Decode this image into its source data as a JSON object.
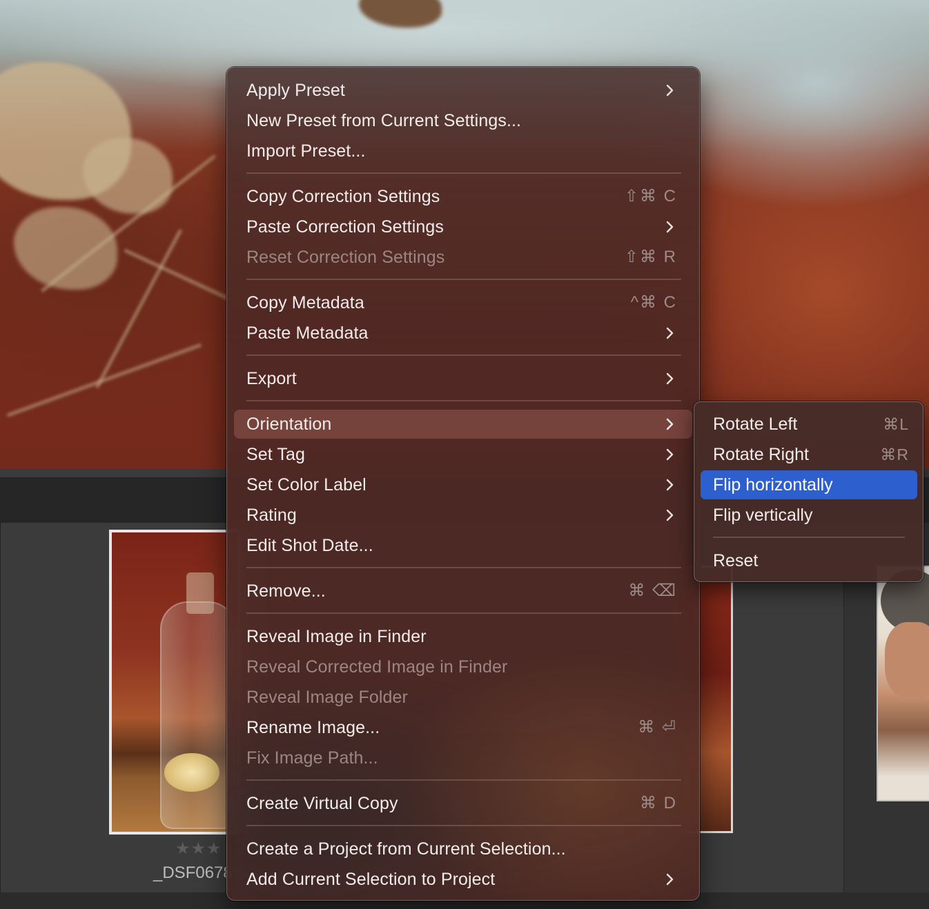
{
  "menu": {
    "items": [
      {
        "label": "Apply Preset",
        "shortcut": "",
        "submenu": true
      },
      {
        "label": "New Preset from Current Settings...",
        "shortcut": ""
      },
      {
        "label": "Import Preset...",
        "shortcut": ""
      },
      {
        "label": "Copy Correction Settings",
        "shortcut": "⇧⌘ C"
      },
      {
        "label": "Paste Correction Settings",
        "shortcut": "",
        "submenu": true
      },
      {
        "label": "Reset Correction Settings",
        "shortcut": "⇧⌘ R",
        "disabled": true
      },
      {
        "label": "Copy Metadata",
        "shortcut": "^⌘ C"
      },
      {
        "label": "Paste Metadata",
        "shortcut": "",
        "submenu": true
      },
      {
        "label": "Export",
        "shortcut": "",
        "submenu": true
      },
      {
        "label": "Orientation",
        "shortcut": "",
        "submenu": true,
        "highlighted": true
      },
      {
        "label": "Set Tag",
        "shortcut": "",
        "submenu": true
      },
      {
        "label": "Set Color Label",
        "shortcut": "",
        "submenu": true
      },
      {
        "label": "Rating",
        "shortcut": "",
        "submenu": true
      },
      {
        "label": "Edit Shot Date...",
        "shortcut": ""
      },
      {
        "label": "Remove...",
        "shortcut": "⌘ ⌫"
      },
      {
        "label": "Reveal Image in Finder",
        "shortcut": ""
      },
      {
        "label": "Reveal Corrected Image in Finder",
        "shortcut": "",
        "disabled": true
      },
      {
        "label": "Reveal Image Folder",
        "shortcut": "",
        "disabled": true
      },
      {
        "label": "Rename Image...",
        "shortcut": "⌘ ⏎"
      },
      {
        "label": "Fix Image Path...",
        "shortcut": "",
        "disabled": true
      },
      {
        "label": "Create Virtual Copy",
        "shortcut": "⌘ D"
      },
      {
        "label": "Create a Project from Current Selection...",
        "shortcut": ""
      },
      {
        "label": "Add Current Selection to Project",
        "shortcut": "",
        "submenu": true
      }
    ]
  },
  "orientation_submenu": {
    "items": [
      {
        "label": "Rotate Left",
        "shortcut": "⌘L"
      },
      {
        "label": "Rotate Right",
        "shortcut": "⌘R"
      },
      {
        "label": "Flip horizontally",
        "shortcut": "",
        "selected": true
      },
      {
        "label": "Flip vertically",
        "shortcut": ""
      },
      {
        "label": "Reset",
        "shortcut": ""
      }
    ]
  },
  "filmstrip": {
    "thumb1_rating": "★★★",
    "thumb1_name": "_DSF0678"
  },
  "colors": {
    "selection_blue": "#2e5fcf",
    "menu_bg": "#4e2824",
    "disabled_text": "#9c8683"
  }
}
